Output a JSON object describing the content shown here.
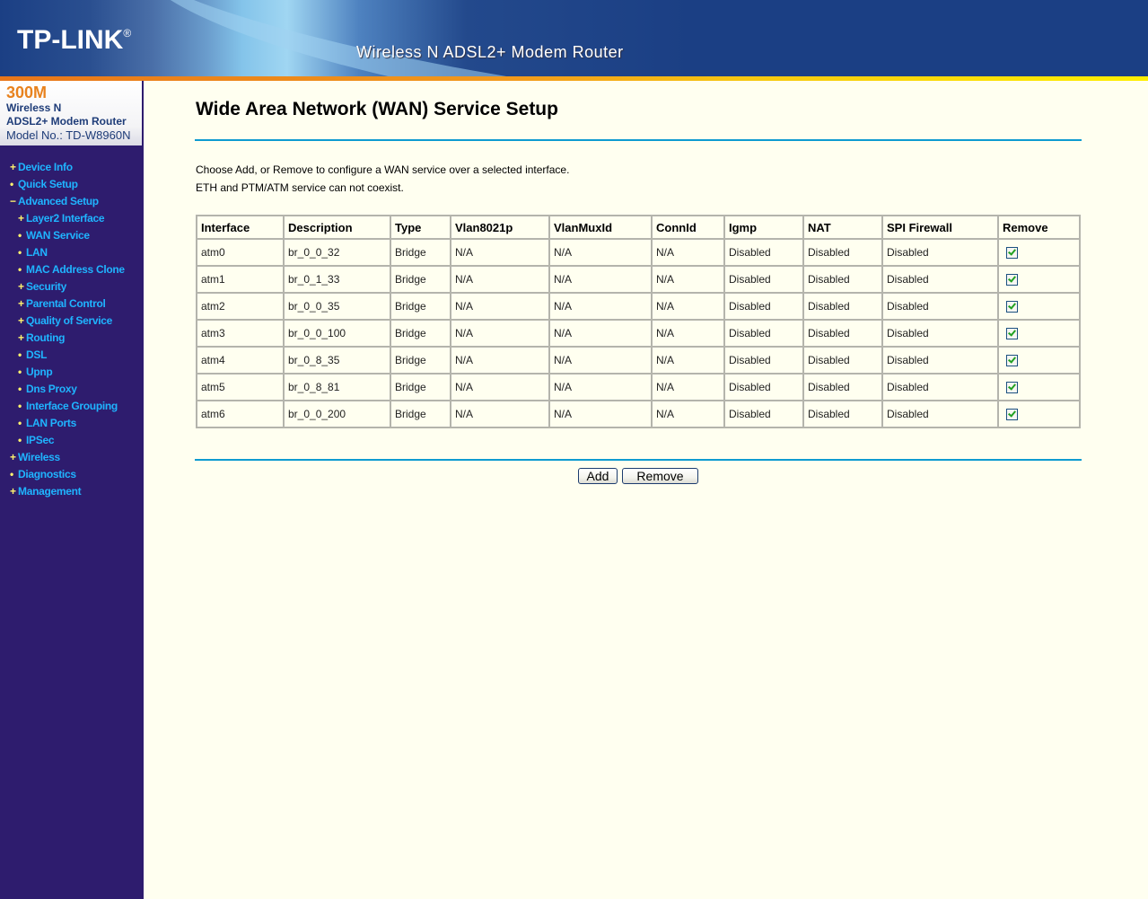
{
  "header": {
    "logo": "TP-LINK",
    "logo_mark": "®",
    "product_title": "Wireless N ADSL2+ Modem Router"
  },
  "model_box": {
    "speed": "300M",
    "line1": "Wireless N",
    "line2": "ADSL2+ Modem Router",
    "model": "Model No.: TD-W8960N"
  },
  "sidebar": {
    "items": [
      {
        "label": "Device Info",
        "icon": "+",
        "level": 1
      },
      {
        "label": "Quick Setup",
        "icon": "•",
        "level": 1
      },
      {
        "label": "Advanced Setup",
        "icon": "−",
        "level": 1
      },
      {
        "label": "Layer2 Interface",
        "icon": "+",
        "level": 2
      },
      {
        "label": "WAN Service",
        "icon": "•",
        "level": 2
      },
      {
        "label": "LAN",
        "icon": "•",
        "level": 2
      },
      {
        "label": "MAC Address Clone",
        "icon": "•",
        "level": 2
      },
      {
        "label": "Security",
        "icon": "+",
        "level": 2
      },
      {
        "label": "Parental Control",
        "icon": "+",
        "level": 2
      },
      {
        "label": "Quality of Service",
        "icon": "+",
        "level": 2
      },
      {
        "label": "Routing",
        "icon": "+",
        "level": 2
      },
      {
        "label": "DSL",
        "icon": "•",
        "level": 2
      },
      {
        "label": "Upnp",
        "icon": "•",
        "level": 2
      },
      {
        "label": "Dns Proxy",
        "icon": "•",
        "level": 2
      },
      {
        "label": "Interface Grouping",
        "icon": "•",
        "level": 2
      },
      {
        "label": "LAN Ports",
        "icon": "•",
        "level": 2
      },
      {
        "label": "IPSec",
        "icon": "•",
        "level": 2
      },
      {
        "label": "Wireless",
        "icon": "+",
        "level": 1
      },
      {
        "label": "Diagnostics",
        "icon": "•",
        "level": 1
      },
      {
        "label": "Management",
        "icon": "+",
        "level": 1
      }
    ]
  },
  "main": {
    "title": "Wide Area Network (WAN) Service Setup",
    "description_line1": "Choose Add, or Remove to configure a WAN service over a selected interface.",
    "description_line2": "ETH and PTM/ATM service can not coexist.",
    "table": {
      "columns": [
        "Interface",
        "Description",
        "Type",
        "Vlan8021p",
        "VlanMuxId",
        "ConnId",
        "Igmp",
        "NAT",
        "SPI Firewall",
        "Remove"
      ],
      "rows": [
        {
          "interface": "atm0",
          "description": "br_0_0_32",
          "type": "Bridge",
          "vlan8021p": "N/A",
          "vlanmuxid": "N/A",
          "connid": "N/A",
          "igmp": "Disabled",
          "nat": "Disabled",
          "spi_firewall": "Disabled",
          "remove_checked": true
        },
        {
          "interface": "atm1",
          "description": "br_0_1_33",
          "type": "Bridge",
          "vlan8021p": "N/A",
          "vlanmuxid": "N/A",
          "connid": "N/A",
          "igmp": "Disabled",
          "nat": "Disabled",
          "spi_firewall": "Disabled",
          "remove_checked": true
        },
        {
          "interface": "atm2",
          "description": "br_0_0_35",
          "type": "Bridge",
          "vlan8021p": "N/A",
          "vlanmuxid": "N/A",
          "connid": "N/A",
          "igmp": "Disabled",
          "nat": "Disabled",
          "spi_firewall": "Disabled",
          "remove_checked": true
        },
        {
          "interface": "atm3",
          "description": "br_0_0_100",
          "type": "Bridge",
          "vlan8021p": "N/A",
          "vlanmuxid": "N/A",
          "connid": "N/A",
          "igmp": "Disabled",
          "nat": "Disabled",
          "spi_firewall": "Disabled",
          "remove_checked": true
        },
        {
          "interface": "atm4",
          "description": "br_0_8_35",
          "type": "Bridge",
          "vlan8021p": "N/A",
          "vlanmuxid": "N/A",
          "connid": "N/A",
          "igmp": "Disabled",
          "nat": "Disabled",
          "spi_firewall": "Disabled",
          "remove_checked": true
        },
        {
          "interface": "atm5",
          "description": "br_0_8_81",
          "type": "Bridge",
          "vlan8021p": "N/A",
          "vlanmuxid": "N/A",
          "connid": "N/A",
          "igmp": "Disabled",
          "nat": "Disabled",
          "spi_firewall": "Disabled",
          "remove_checked": true
        },
        {
          "interface": "atm6",
          "description": "br_0_0_200",
          "type": "Bridge",
          "vlan8021p": "N/A",
          "vlanmuxid": "N/A",
          "connid": "N/A",
          "igmp": "Disabled",
          "nat": "Disabled",
          "spi_firewall": "Disabled",
          "remove_checked": true
        }
      ]
    },
    "buttons": {
      "add": "Add",
      "remove": "Remove"
    }
  }
}
